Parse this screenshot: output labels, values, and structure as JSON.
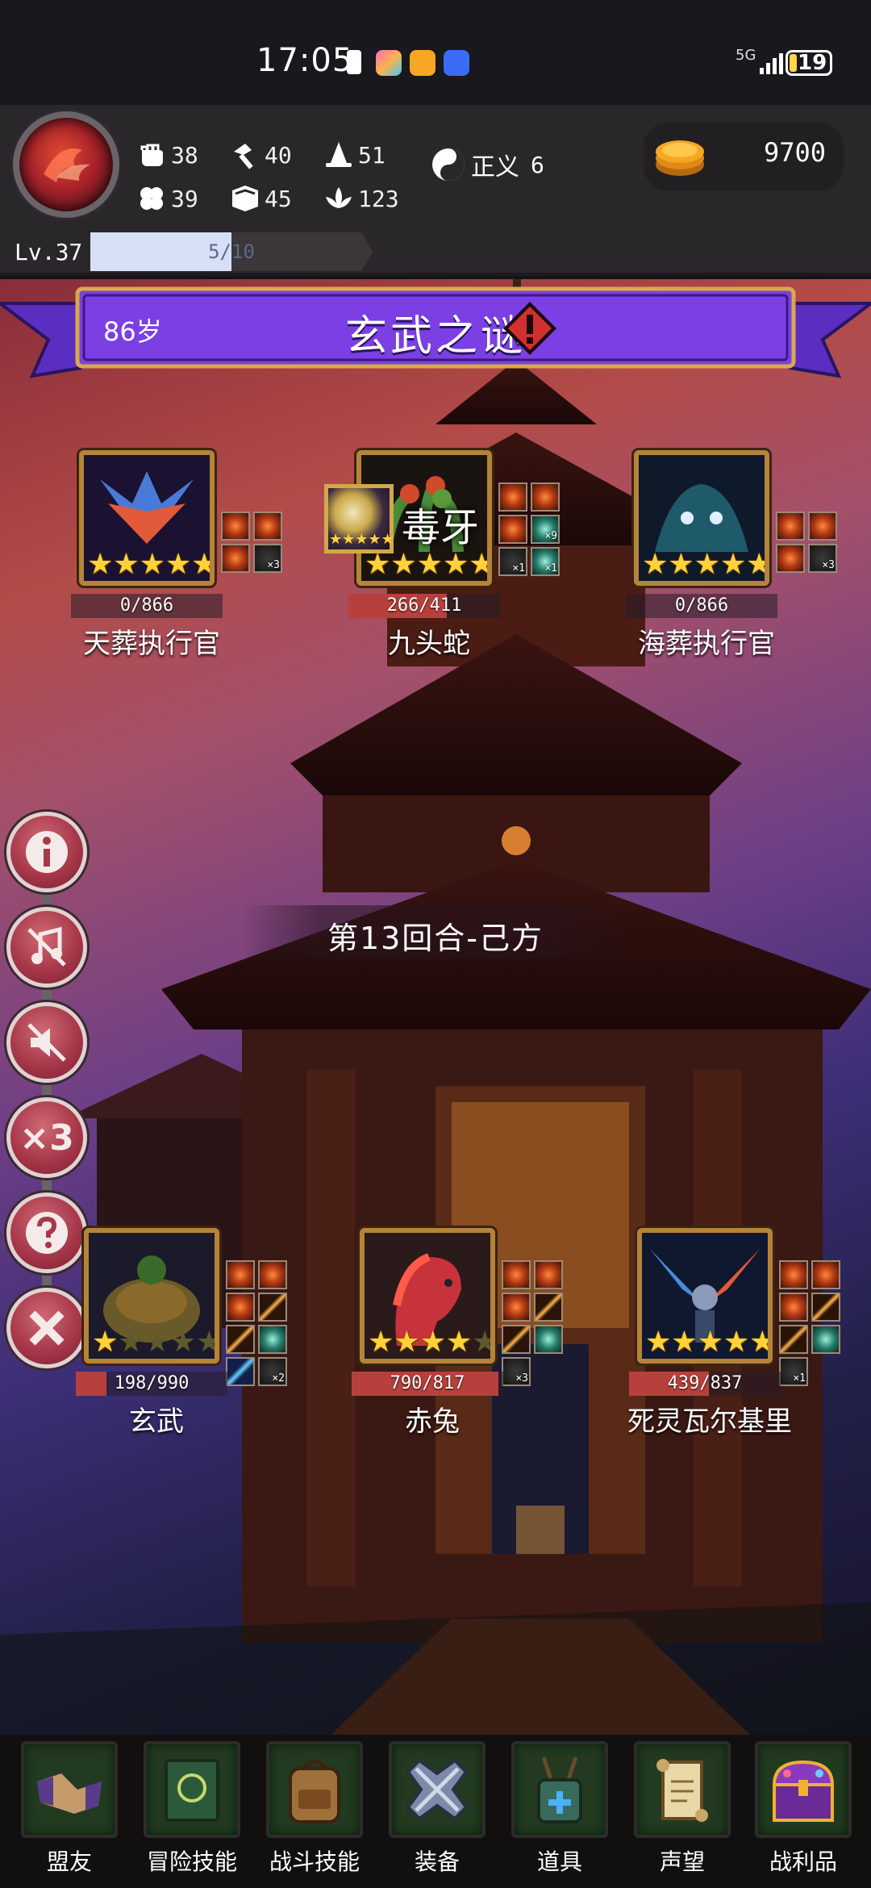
{
  "status_bar": {
    "time": "17:05",
    "network": "5G",
    "battery": "19",
    "battery_level": 0.19
  },
  "hud": {
    "stats": [
      {
        "icon": "fist-icon",
        "value": "38"
      },
      {
        "icon": "hammer-icon",
        "value": "40"
      },
      {
        "icon": "wizard-hat-icon",
        "value": "51"
      },
      {
        "icon": "clover-icon",
        "value": "39"
      },
      {
        "icon": "book-icon",
        "value": "45"
      },
      {
        "icon": "lotus-icon",
        "value": "123"
      }
    ],
    "alignment": {
      "icon": "yin-yang-icon",
      "label": "正义",
      "value": "6"
    },
    "gold": "9700",
    "level": "Lv.37",
    "xp": {
      "text": "5/10",
      "fraction": 0.5
    }
  },
  "banner": {
    "age": "86岁",
    "title": "玄武之谜"
  },
  "enemies": [
    {
      "name": "天葬执行官",
      "hp": "0/866",
      "hp_fraction": 0.0,
      "stars": 5,
      "max_stars": 5,
      "buffs": [
        {
          "style": "fire"
        },
        {
          "style": "fire"
        },
        {
          "style": "fire"
        },
        {
          "style": "dark",
          "count": "3"
        }
      ]
    },
    {
      "name": "九头蛇",
      "hp": "266/411",
      "hp_fraction": 0.647,
      "stars": 5,
      "max_stars": 5,
      "buffs": [
        {
          "style": "fire"
        },
        {
          "style": "fire"
        },
        {
          "style": "fire"
        },
        {
          "style": "teal",
          "count": "9"
        },
        {
          "style": "dark",
          "count": "1"
        },
        {
          "style": "teal",
          "count": "1"
        }
      ]
    },
    {
      "name": "海葬执行官",
      "hp": "0/866",
      "hp_fraction": 0.0,
      "stars": 5,
      "max_stars": 5,
      "buffs": [
        {
          "style": "fire"
        },
        {
          "style": "fire"
        },
        {
          "style": "fire"
        },
        {
          "style": "dark",
          "count": "3"
        }
      ]
    }
  ],
  "skill_popup": {
    "name": "毒牙",
    "stars": "★★★★★"
  },
  "round": "第13回合-己方",
  "allies": [
    {
      "name": "玄武",
      "hp": "198/990",
      "hp_fraction": 0.2,
      "stars": 1,
      "max_stars": 5,
      "buffs": [
        {
          "style": "fire"
        },
        {
          "style": "fire"
        },
        {
          "style": "fire"
        },
        {
          "style": "slash"
        },
        {
          "style": "slash"
        },
        {
          "style": "teal"
        },
        {
          "style": "blue"
        },
        {
          "style": "dark",
          "count": "2"
        }
      ]
    },
    {
      "name": "赤兔",
      "hp": "790/817",
      "hp_fraction": 0.967,
      "stars": 4,
      "max_stars": 5,
      "buffs": [
        {
          "style": "fire"
        },
        {
          "style": "fire"
        },
        {
          "style": "fire"
        },
        {
          "style": "slash"
        },
        {
          "style": "slash"
        },
        {
          "style": "teal"
        },
        {
          "style": "dark",
          "count": "3"
        }
      ]
    },
    {
      "name": "死灵瓦尔基里",
      "hp": "439/837",
      "hp_fraction": 0.524,
      "stars": 5,
      "max_stars": 5,
      "buffs": [
        {
          "style": "fire"
        },
        {
          "style": "fire"
        },
        {
          "style": "fire"
        },
        {
          "style": "slash"
        },
        {
          "style": "slash"
        },
        {
          "style": "teal"
        },
        {
          "style": "dark",
          "count": "1"
        }
      ]
    }
  ],
  "controls": [
    "info-icon",
    "music-off-icon",
    "sound-off-icon",
    "speed-x3-icon",
    "help-icon",
    "close-icon"
  ],
  "controls_label_speed": "×3",
  "bottom_nav": [
    {
      "icon": "handshake-icon",
      "label": "盟友"
    },
    {
      "icon": "spellbook-icon",
      "label": "冒险技能"
    },
    {
      "icon": "backpack-icon",
      "label": "战斗技能"
    },
    {
      "icon": "crossed-swords-icon",
      "label": "装备"
    },
    {
      "icon": "satchel-icon",
      "label": "道具"
    },
    {
      "icon": "scroll-icon",
      "label": "声望"
    },
    {
      "icon": "treasure-chest-icon",
      "label": "战利品"
    }
  ],
  "colors": {
    "banner": "#7b3fe4",
    "hp_fill": "#b8403c",
    "star": "#ffd23a",
    "frame_gold": "#b58339",
    "control_button": "#a7384a",
    "nav_tile": "#213a20"
  }
}
